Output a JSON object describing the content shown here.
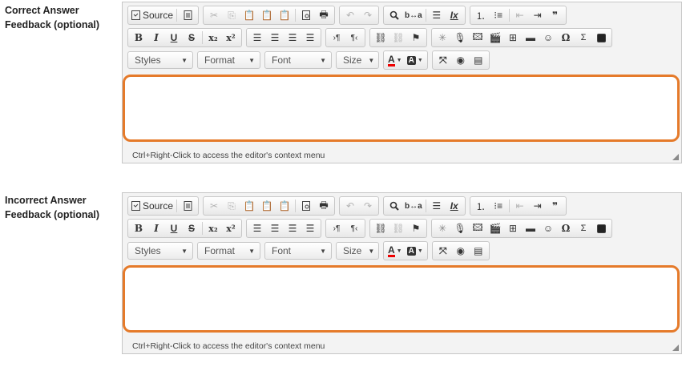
{
  "fields": [
    {
      "label_line1": "Correct Answer",
      "label_line2": "Feedback (optional)",
      "content_value": "",
      "status_hint": "Ctrl+Right-Click to access the editor's context menu"
    },
    {
      "label_line1": "Incorrect Answer",
      "label_line2": "Feedback (optional)",
      "content_value": "",
      "status_hint": "Ctrl+Right-Click to access the editor's context menu"
    }
  ],
  "toolbar": {
    "source_label": "Source",
    "bold_glyph": "B",
    "italic_glyph": "I",
    "underline_glyph": "U",
    "strike_glyph": "S",
    "subscript_glyph": "x₂",
    "superscript_glyph": "x²",
    "styles_label": "Styles",
    "format_label": "Format",
    "font_label": "Font",
    "size_label": "Size",
    "text_color_glyph": "A",
    "bg_color_glyph": "A",
    "omega_glyph": "Ω",
    "sigma_glyph": "Σ",
    "quote_glyph": "❞",
    "pilcrow_ltr_glyph": "›¶",
    "pilcrow_rtl_glyph": "¶‹"
  },
  "colors": {
    "focus_border": "#e57a2a",
    "toolbar_bg": "#f3f3f3"
  }
}
